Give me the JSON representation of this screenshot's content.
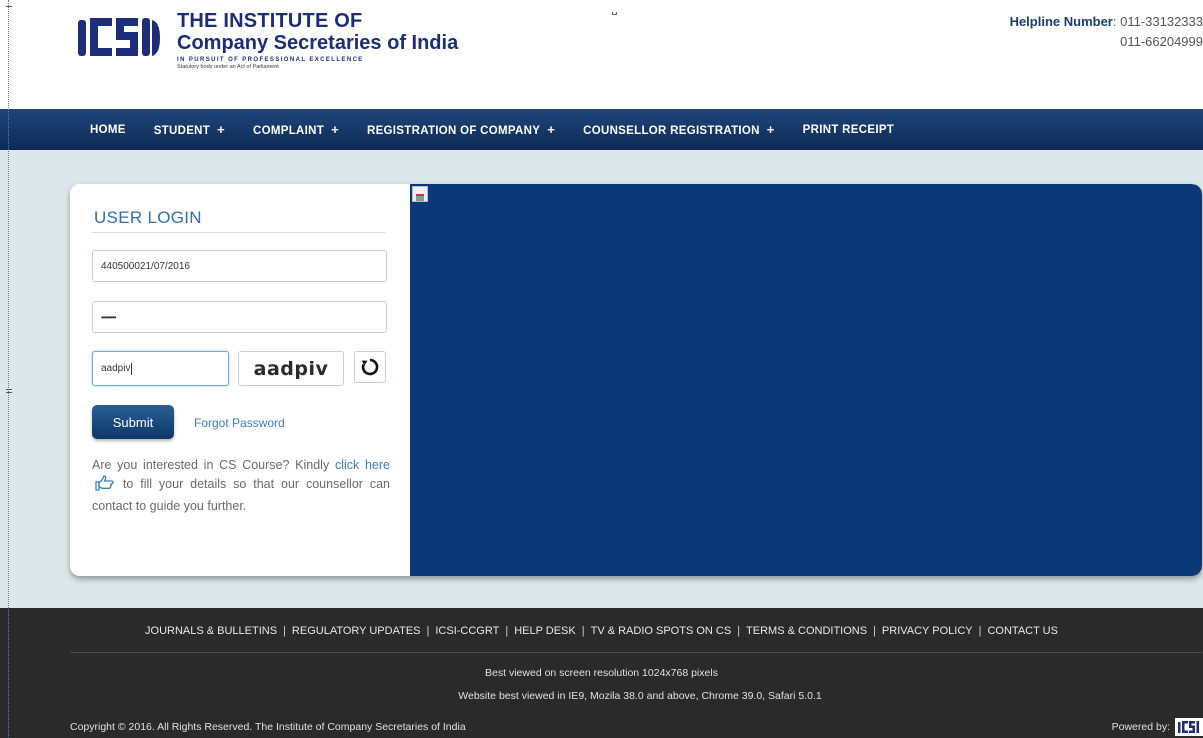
{
  "header": {
    "org_line1": "THE INSTITUTE OF",
    "org_line2": "Company Secretaries of India",
    "tagline": "IN PURSUIT OF PROFESSIONAL EXCELLENCE",
    "subtagline": "Statutory body under an Act of Parliament",
    "helpline_label": "Helpline Number",
    "helpline_1": "011-33132333",
    "helpline_2": "011-66204999"
  },
  "nav": {
    "items": [
      {
        "label": "HOME",
        "has_plus": false
      },
      {
        "label": "STUDENT",
        "has_plus": true
      },
      {
        "label": "COMPLAINT",
        "has_plus": true
      },
      {
        "label": "REGISTRATION OF COMPANY",
        "has_plus": true
      },
      {
        "label": "COUNSELLOR REGISTRATION",
        "has_plus": true
      },
      {
        "label": "PRINT RECEIPT",
        "has_plus": false
      }
    ],
    "plus_symbol": "+"
  },
  "login": {
    "title": "USER LOGIN",
    "username_value": "440500021/07/2016",
    "password_value": "••••••••",
    "captcha_input_value": "aadpiv",
    "captcha_text": "aadpiv",
    "submit_label": "Submit",
    "forgot_label": "Forgot Password",
    "info_prefix": "Are you interested in CS Course? Kindly",
    "info_link": "click here",
    "info_suffix": "to fill your details so that our counsellor can contact to guide you further."
  },
  "footer": {
    "links": [
      "JOURNALS & BULLETINS",
      "REGULATORY UPDATES",
      "ICSI-CCGRT",
      "HELP DESK",
      "TV & RADIO SPOTS ON CS",
      "TERMS & CONDITIONS",
      "PRIVACY POLICY",
      "CONTACT US"
    ],
    "separator": "|",
    "line1": "Best viewed on screen resolution 1024x768 pixels",
    "line2": "Website best viewed in IE9, Mozila 38.0 and above, Chrome 39.0, Safari 5.0.1",
    "copyright": "Copyright © 2016. All Rights Reserved. The Institute of Company Secretaries of India",
    "powered_by": "Powered by:"
  },
  "colors": {
    "navy": "#0b3879",
    "brand_blue": "#1c2e7a",
    "link_blue": "#3b7cc0",
    "footer_bg": "#2a2a2a"
  }
}
